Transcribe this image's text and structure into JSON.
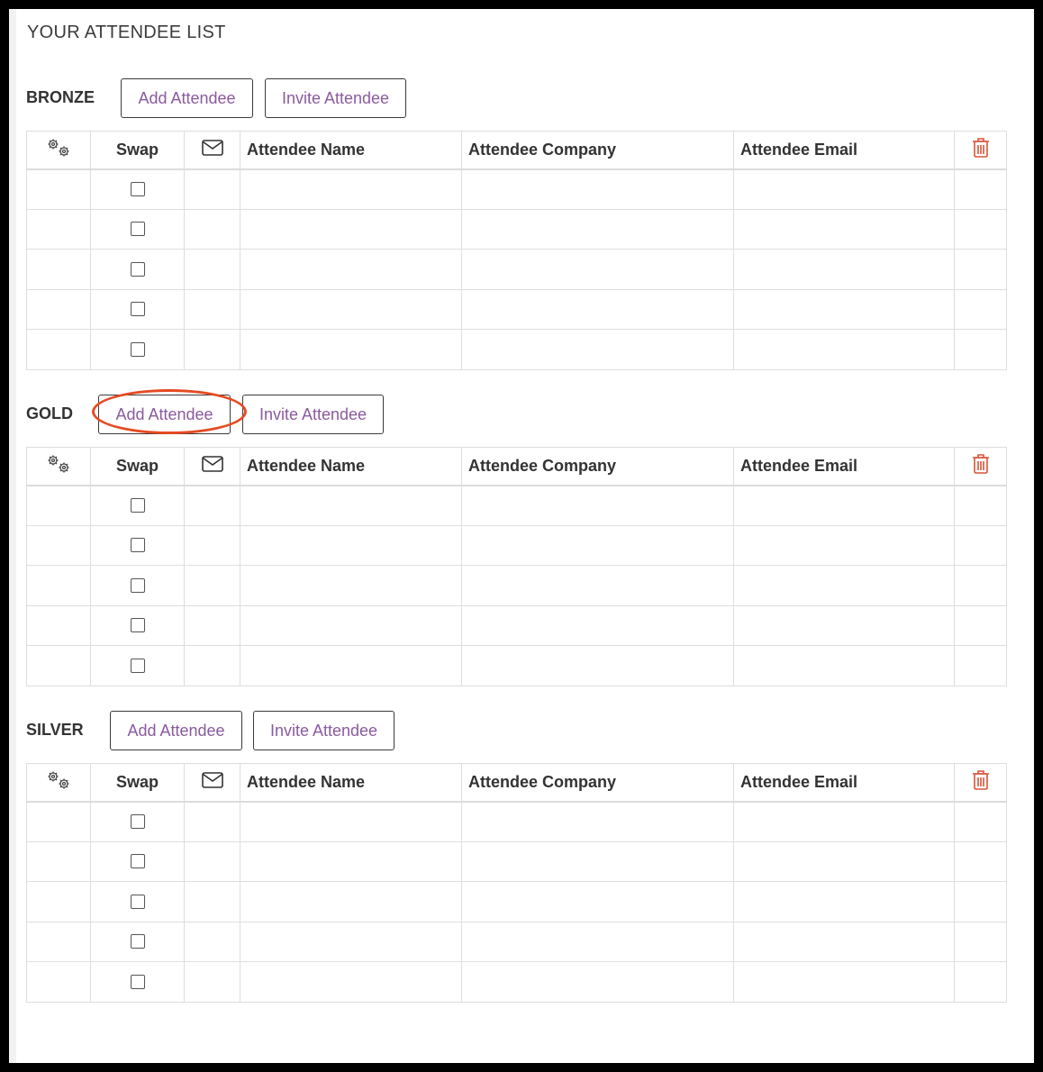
{
  "page": {
    "title": "YOUR ATTENDEE LIST"
  },
  "table_headers": {
    "settings_icon": "gears-icon",
    "swap": "Swap",
    "email_icon": "envelope-icon",
    "name": "Attendee Name",
    "company": "Attendee Company",
    "email": "Attendee Email",
    "delete_icon": "trash-icon"
  },
  "sections": [
    {
      "tier": "BRONZE",
      "add_label": "Add Attendee",
      "invite_label": "Invite Attendee",
      "row_count": 5
    },
    {
      "tier": "GOLD",
      "add_label": "Add Attendee",
      "invite_label": "Invite Attendee",
      "row_count": 5
    },
    {
      "tier": "SILVER",
      "add_label": "Add Attendee",
      "invite_label": "Invite Attendee",
      "row_count": 5
    }
  ],
  "colors": {
    "accent": "#8a5a9e",
    "delete": "#d9533a",
    "highlight": "#e64a22"
  }
}
